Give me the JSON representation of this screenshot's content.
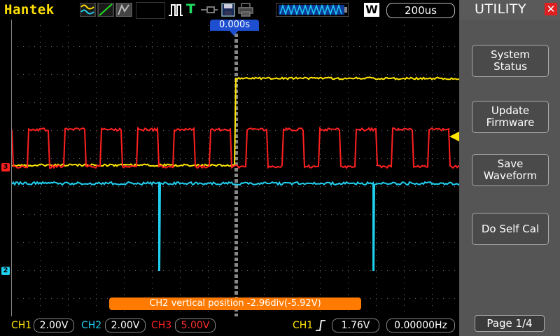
{
  "header": {
    "brand": "Hantek",
    "run_indicator": "T",
    "timebase_mode": "W",
    "timebase": "200us",
    "trigger_time": "0.000s"
  },
  "panel": {
    "title": "UTILITY",
    "buttons": [
      {
        "line1": "System",
        "line2": "Status"
      },
      {
        "line1": "Update",
        "line2": "Firmware"
      },
      {
        "line1": "Save",
        "line2": "Waveform"
      },
      {
        "line1": "Do Self Cal",
        "line2": ""
      }
    ],
    "page": "Page 1/4"
  },
  "message": "CH2 vertical position -2.96div(-5.92V)",
  "channels": [
    {
      "label": "CH1",
      "scale": "2.00V",
      "color": "#ffe600"
    },
    {
      "label": "CH2",
      "scale": "2.00V",
      "color": "#20d0f0"
    },
    {
      "label": "CH3",
      "scale": "5.00V",
      "color": "#ff2020"
    }
  ],
  "trigger": {
    "source": "CH1",
    "level": "1.76V",
    "frequency": "0.00000Hz"
  },
  "markers": {
    "ch3": "3",
    "ch2": "2"
  },
  "colors": {
    "ch1": "#ffe600",
    "ch2": "#20d0f0",
    "ch3": "#ff2020",
    "accent": "#ff7a00"
  }
}
